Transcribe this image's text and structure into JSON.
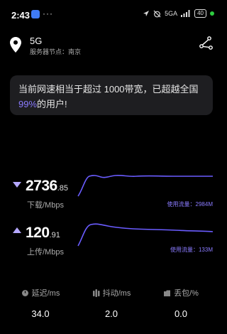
{
  "status_bar": {
    "time": "2:43",
    "dots": "···",
    "network": "5GA",
    "battery": "40"
  },
  "server": {
    "name": "5G",
    "node": "服务器节点：南京"
  },
  "banner": {
    "prefix": "当前网速相当于超过 1000带宽，已超越全国",
    "percent": "99%",
    "suffix": "的用户!"
  },
  "download": {
    "value_int": "2736",
    "value_dec": ".85",
    "unit": "下载/Mbps",
    "usage": "使用流量：2984M"
  },
  "upload": {
    "value_int": "120",
    "value_dec": ".91",
    "unit": "上传/Mbps",
    "usage": "使用流量：133M"
  },
  "stats": {
    "latency": {
      "label": "延迟/ms",
      "value": "34.0"
    },
    "jitter": {
      "label": "抖动/ms",
      "value": "2.0"
    },
    "loss": {
      "label": "丢包/%",
      "value": "0.0"
    }
  },
  "colors": {
    "accent": "#8a7bff",
    "line": "#6a5cff",
    "background": "#000000"
  }
}
